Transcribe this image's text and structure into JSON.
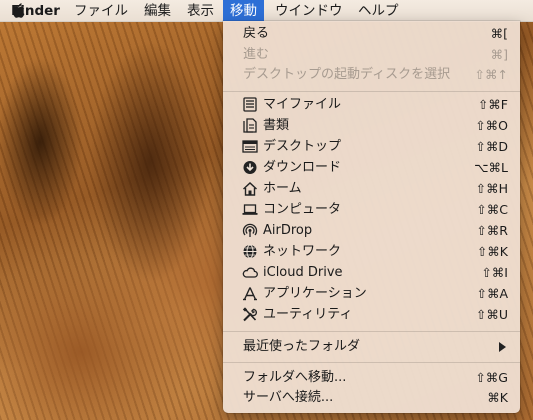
{
  "menubar": {
    "apple_icon": "apple-icon",
    "items": [
      {
        "label": "Finder"
      },
      {
        "label": "ファイル"
      },
      {
        "label": "編集"
      },
      {
        "label": "表示"
      },
      {
        "label": "移動"
      },
      {
        "label": "ウインドウ"
      },
      {
        "label": "ヘルプ"
      }
    ]
  },
  "go_menu": {
    "history": [
      {
        "label": "戻る",
        "shortcut": "⌘[",
        "enabled": true
      },
      {
        "label": "進む",
        "shortcut": "⌘]",
        "enabled": false
      },
      {
        "label": "デスクトップの起動ディスクを選択",
        "shortcut": "⇧⌘↑",
        "enabled": false
      }
    ],
    "places": [
      {
        "label": "マイファイル",
        "shortcut": "⇧⌘F",
        "icon": "all-my-files-icon"
      },
      {
        "label": "書類",
        "shortcut": "⇧⌘O",
        "icon": "documents-icon"
      },
      {
        "label": "デスクトップ",
        "shortcut": "⇧⌘D",
        "icon": "desktop-icon"
      },
      {
        "label": "ダウンロード",
        "shortcut": "⌥⌘L",
        "icon": "downloads-icon"
      },
      {
        "label": "ホーム",
        "shortcut": "⇧⌘H",
        "icon": "home-icon"
      },
      {
        "label": "コンピュータ",
        "shortcut": "⇧⌘C",
        "icon": "computer-icon"
      },
      {
        "label": "AirDrop",
        "shortcut": "⇧⌘R",
        "icon": "airdrop-icon"
      },
      {
        "label": "ネットワーク",
        "shortcut": "⇧⌘K",
        "icon": "network-icon"
      },
      {
        "label": "iCloud Drive",
        "shortcut": "⇧⌘I",
        "icon": "icloud-icon"
      },
      {
        "label": "アプリケーション",
        "shortcut": "⇧⌘A",
        "icon": "applications-icon"
      },
      {
        "label": "ユーティリティ",
        "shortcut": "⇧⌘U",
        "icon": "utilities-icon"
      }
    ],
    "recent_folders": {
      "label": "最近使ったフォルダ",
      "icon": "submenu-arrow-icon"
    },
    "go_to_folder": {
      "label": "フォルダへ移動...",
      "shortcut": "⇧⌘G"
    },
    "connect_server": {
      "label": "サーバへ接続...",
      "shortcut": "⌘K"
    }
  },
  "colors": {
    "menu_highlight": "#2d6fd6",
    "menu_background": "#eeded0",
    "disabled_text": "#a79b90"
  }
}
